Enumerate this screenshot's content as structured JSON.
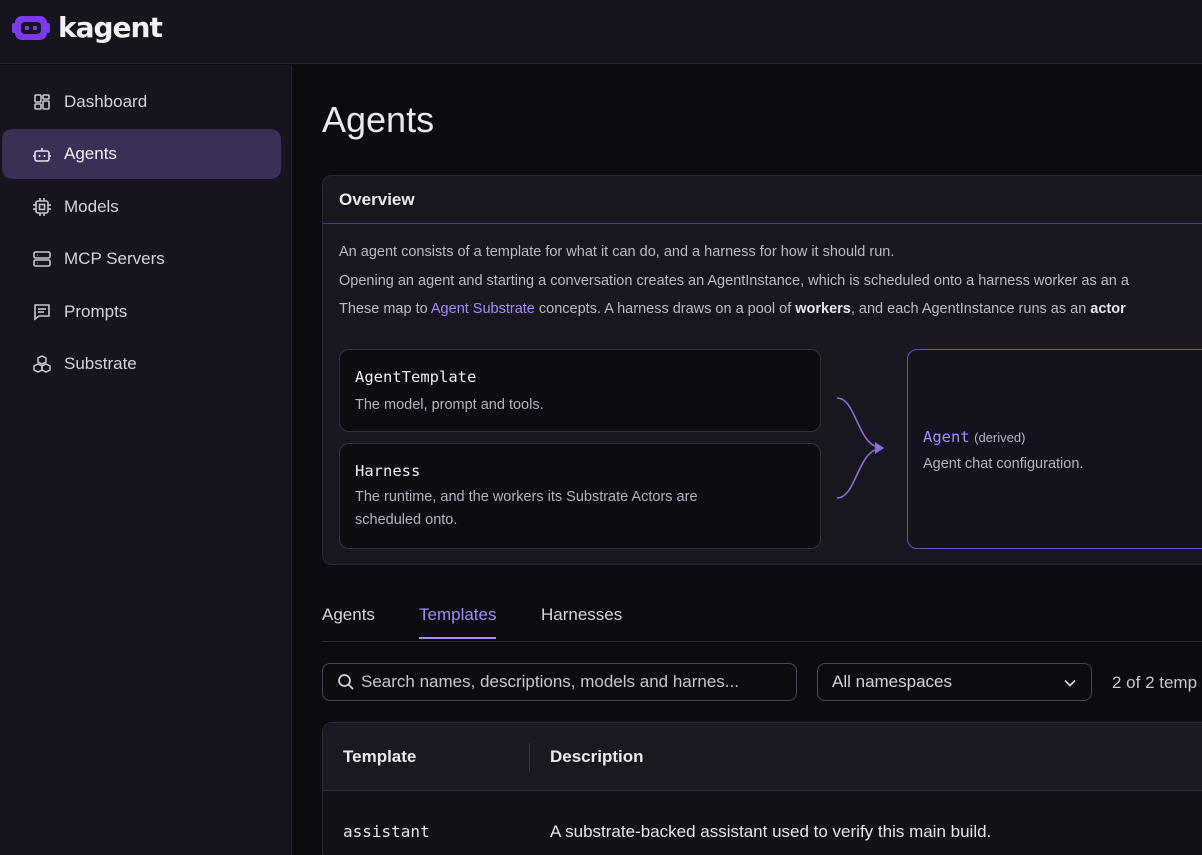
{
  "app": {
    "name": "kagent"
  },
  "colors": {
    "accent": "#a78bfa",
    "brand": "#7c3aed",
    "active_nav": "#3a2f55"
  },
  "sidebar": {
    "items": [
      {
        "label": "Dashboard",
        "icon": "dashboard-icon"
      },
      {
        "label": "Agents",
        "icon": "bot-icon",
        "active": true
      },
      {
        "label": "Models",
        "icon": "cpu-icon"
      },
      {
        "label": "MCP Servers",
        "icon": "server-icon"
      },
      {
        "label": "Prompts",
        "icon": "message-icon"
      },
      {
        "label": "Substrate",
        "icon": "boxes-icon"
      }
    ]
  },
  "page": {
    "title": "Agents"
  },
  "overview": {
    "header": "Overview",
    "line1": "An agent consists of a template for what it can do, and a harness for how it should run.",
    "line2": "Opening an agent and starting a conversation creates an AgentInstance, which is scheduled onto a harness worker as an a",
    "line3_pre": "These map to ",
    "line3_link": "Agent Substrate",
    "line3_mid": " concepts. A harness draws on a pool of ",
    "line3_bold1": "workers",
    "line3_mid2": ", and each AgentInstance runs as an ",
    "line3_bold2": "actor",
    "template_card": {
      "title": "AgentTemplate",
      "desc": "The model, prompt and tools."
    },
    "harness_card": {
      "title": "Harness",
      "desc_line1": "The runtime, and the workers its Substrate Actors are",
      "desc_line2": "scheduled onto."
    },
    "agent_card": {
      "title": "Agent",
      "suffix": "(derived)",
      "desc": "Agent chat configuration."
    }
  },
  "tabs": [
    {
      "label": "Agents"
    },
    {
      "label": "Templates",
      "active": true
    },
    {
      "label": "Harnesses"
    }
  ],
  "filters": {
    "search_placeholder": "Search names, descriptions, models and harnes...",
    "namespace": "All namespaces",
    "count": "2 of 2 temp"
  },
  "table": {
    "columns": [
      "Template",
      "Description"
    ],
    "rows": [
      {
        "template": "assistant",
        "description": "A substrate-backed assistant used to verify this main build."
      }
    ]
  }
}
